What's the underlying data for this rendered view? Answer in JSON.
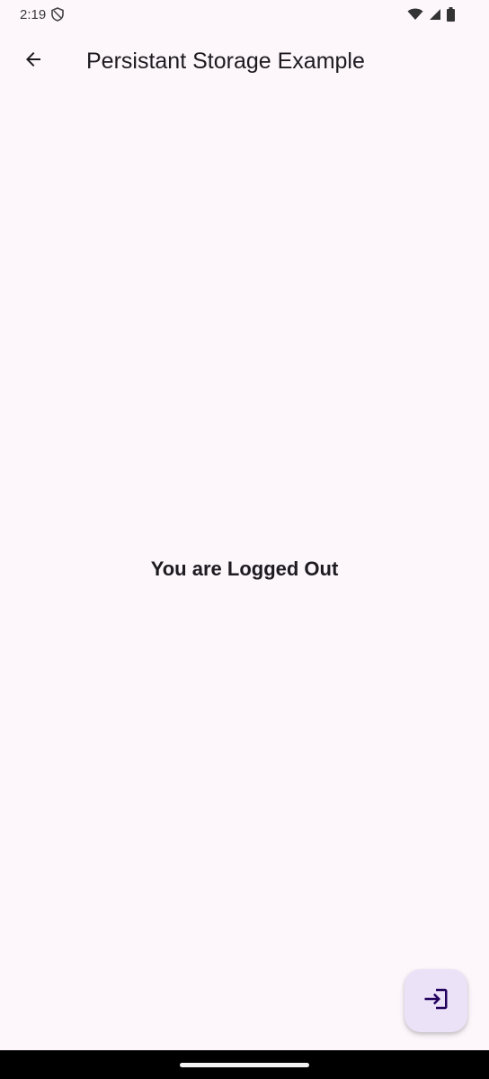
{
  "status_bar": {
    "time": "2:19",
    "icons": [
      "shield-icon",
      "wifi-icon",
      "signal-icon",
      "battery-icon"
    ]
  },
  "app_bar": {
    "back_icon": "arrow-left-icon",
    "title": "Persistant Storage Example"
  },
  "body": {
    "message": "You are Logged Out"
  },
  "fab": {
    "icon": "login-icon"
  },
  "colors": {
    "background": "#fdf7fc",
    "fab_background": "#ece2f8",
    "fab_icon": "#21005d",
    "text": "#1d1b20"
  }
}
